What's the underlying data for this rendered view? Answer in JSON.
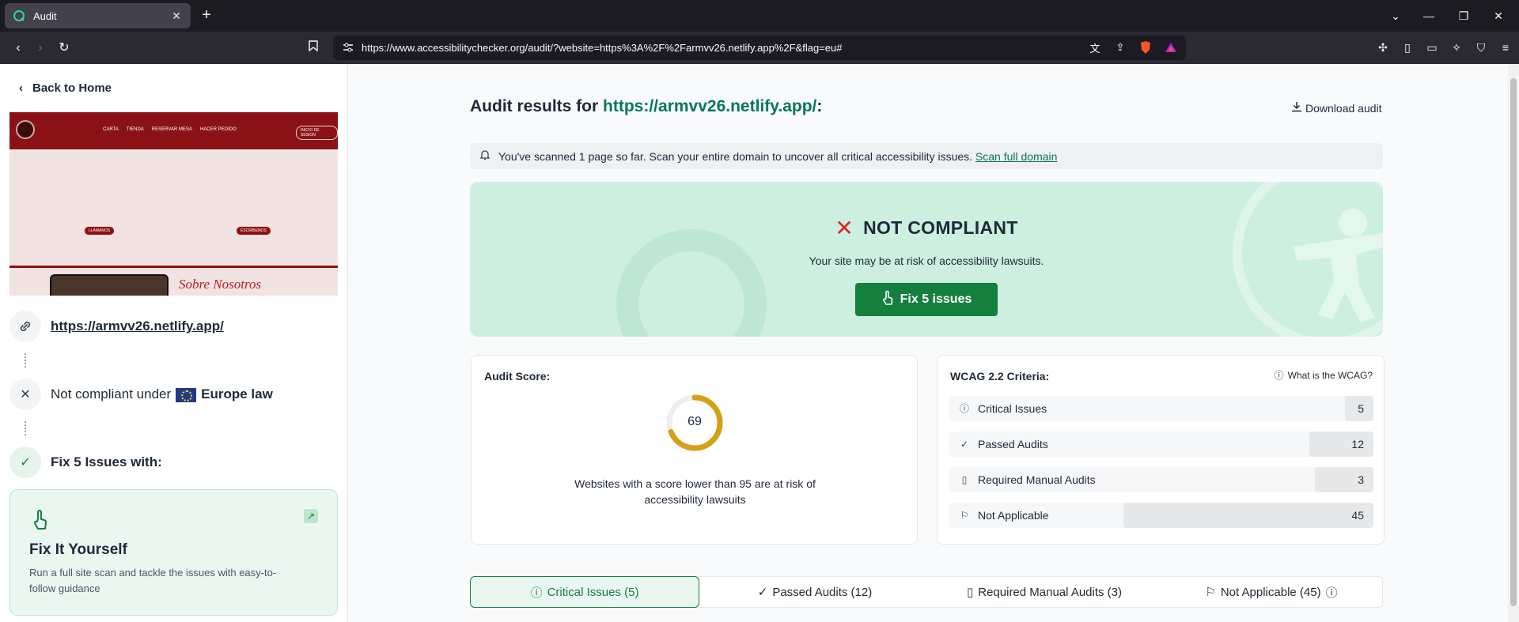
{
  "browser": {
    "tab_title": "Audit",
    "url": "https://www.accessibilitychecker.org/audit/?website=https%3A%2F%2Farmvv26.netlify.app%2F&flag=eu#"
  },
  "sidebar": {
    "back_label": "Back to Home",
    "preview": {
      "nav": [
        "CARTA",
        "TIENDA",
        "RESERVAR MESA",
        "HACER PEDIDO"
      ],
      "login": "INICIO DE SESION",
      "btn_left": "LLÁMANOS",
      "btn_right": "ESCRÍBENOS",
      "about": "Sobre Nosotros"
    },
    "site_link": "https://armvv26.netlify.app/",
    "compliance_prefix": "Not compliant under",
    "compliance_law": "Europe law",
    "fix_heading": "Fix 5 Issues with:",
    "fix_card": {
      "title": "Fix It Yourself",
      "desc": "Run a full site scan and tackle the issues with easy-to-follow guidance"
    }
  },
  "main": {
    "title_prefix": "Audit results for",
    "title_site": "https://armvv26.netlify.app/",
    "title_suffix": ":",
    "download": "Download audit",
    "notice_text": "You've scanned 1 page so far. Scan your entire domain to uncover all critical accessibility issues.",
    "notice_link": "Scan full domain",
    "status": "NOT COMPLIANT",
    "risk": "Your site may be at risk of accessibility lawsuits.",
    "fix_button": "Fix 5 issues",
    "score_label": "Audit Score:",
    "score_value": "69",
    "score_fraction": 0.69,
    "score_note": "Websites with a score lower than 95 are at risk of accessibility lawsuits",
    "wcag_label": "WCAG 2.2 Criteria:",
    "wcag_link": "What is the WCAG?",
    "criteria": [
      {
        "label": "Critical Issues",
        "value": "5",
        "icon": "alert-circle-icon",
        "fraction": 0.067
      },
      {
        "label": "Passed Audits",
        "value": "12",
        "icon": "check-icon",
        "fraction": 0.152
      },
      {
        "label": "Required Manual Audits",
        "value": "3",
        "icon": "document-icon",
        "fraction": 0.138
      },
      {
        "label": "Not Applicable",
        "value": "45",
        "icon": "flag-icon",
        "fraction": 0.59
      }
    ],
    "tabs": [
      {
        "label": "Critical Issues (5)"
      },
      {
        "label": "Passed Audits (12)"
      },
      {
        "label": "Required Manual Audits (3)"
      },
      {
        "label": "Not Applicable (45)"
      }
    ]
  },
  "colors": {
    "brand_green": "#15803d",
    "score_gold": "#d4a017",
    "danger": "#dc2626"
  }
}
